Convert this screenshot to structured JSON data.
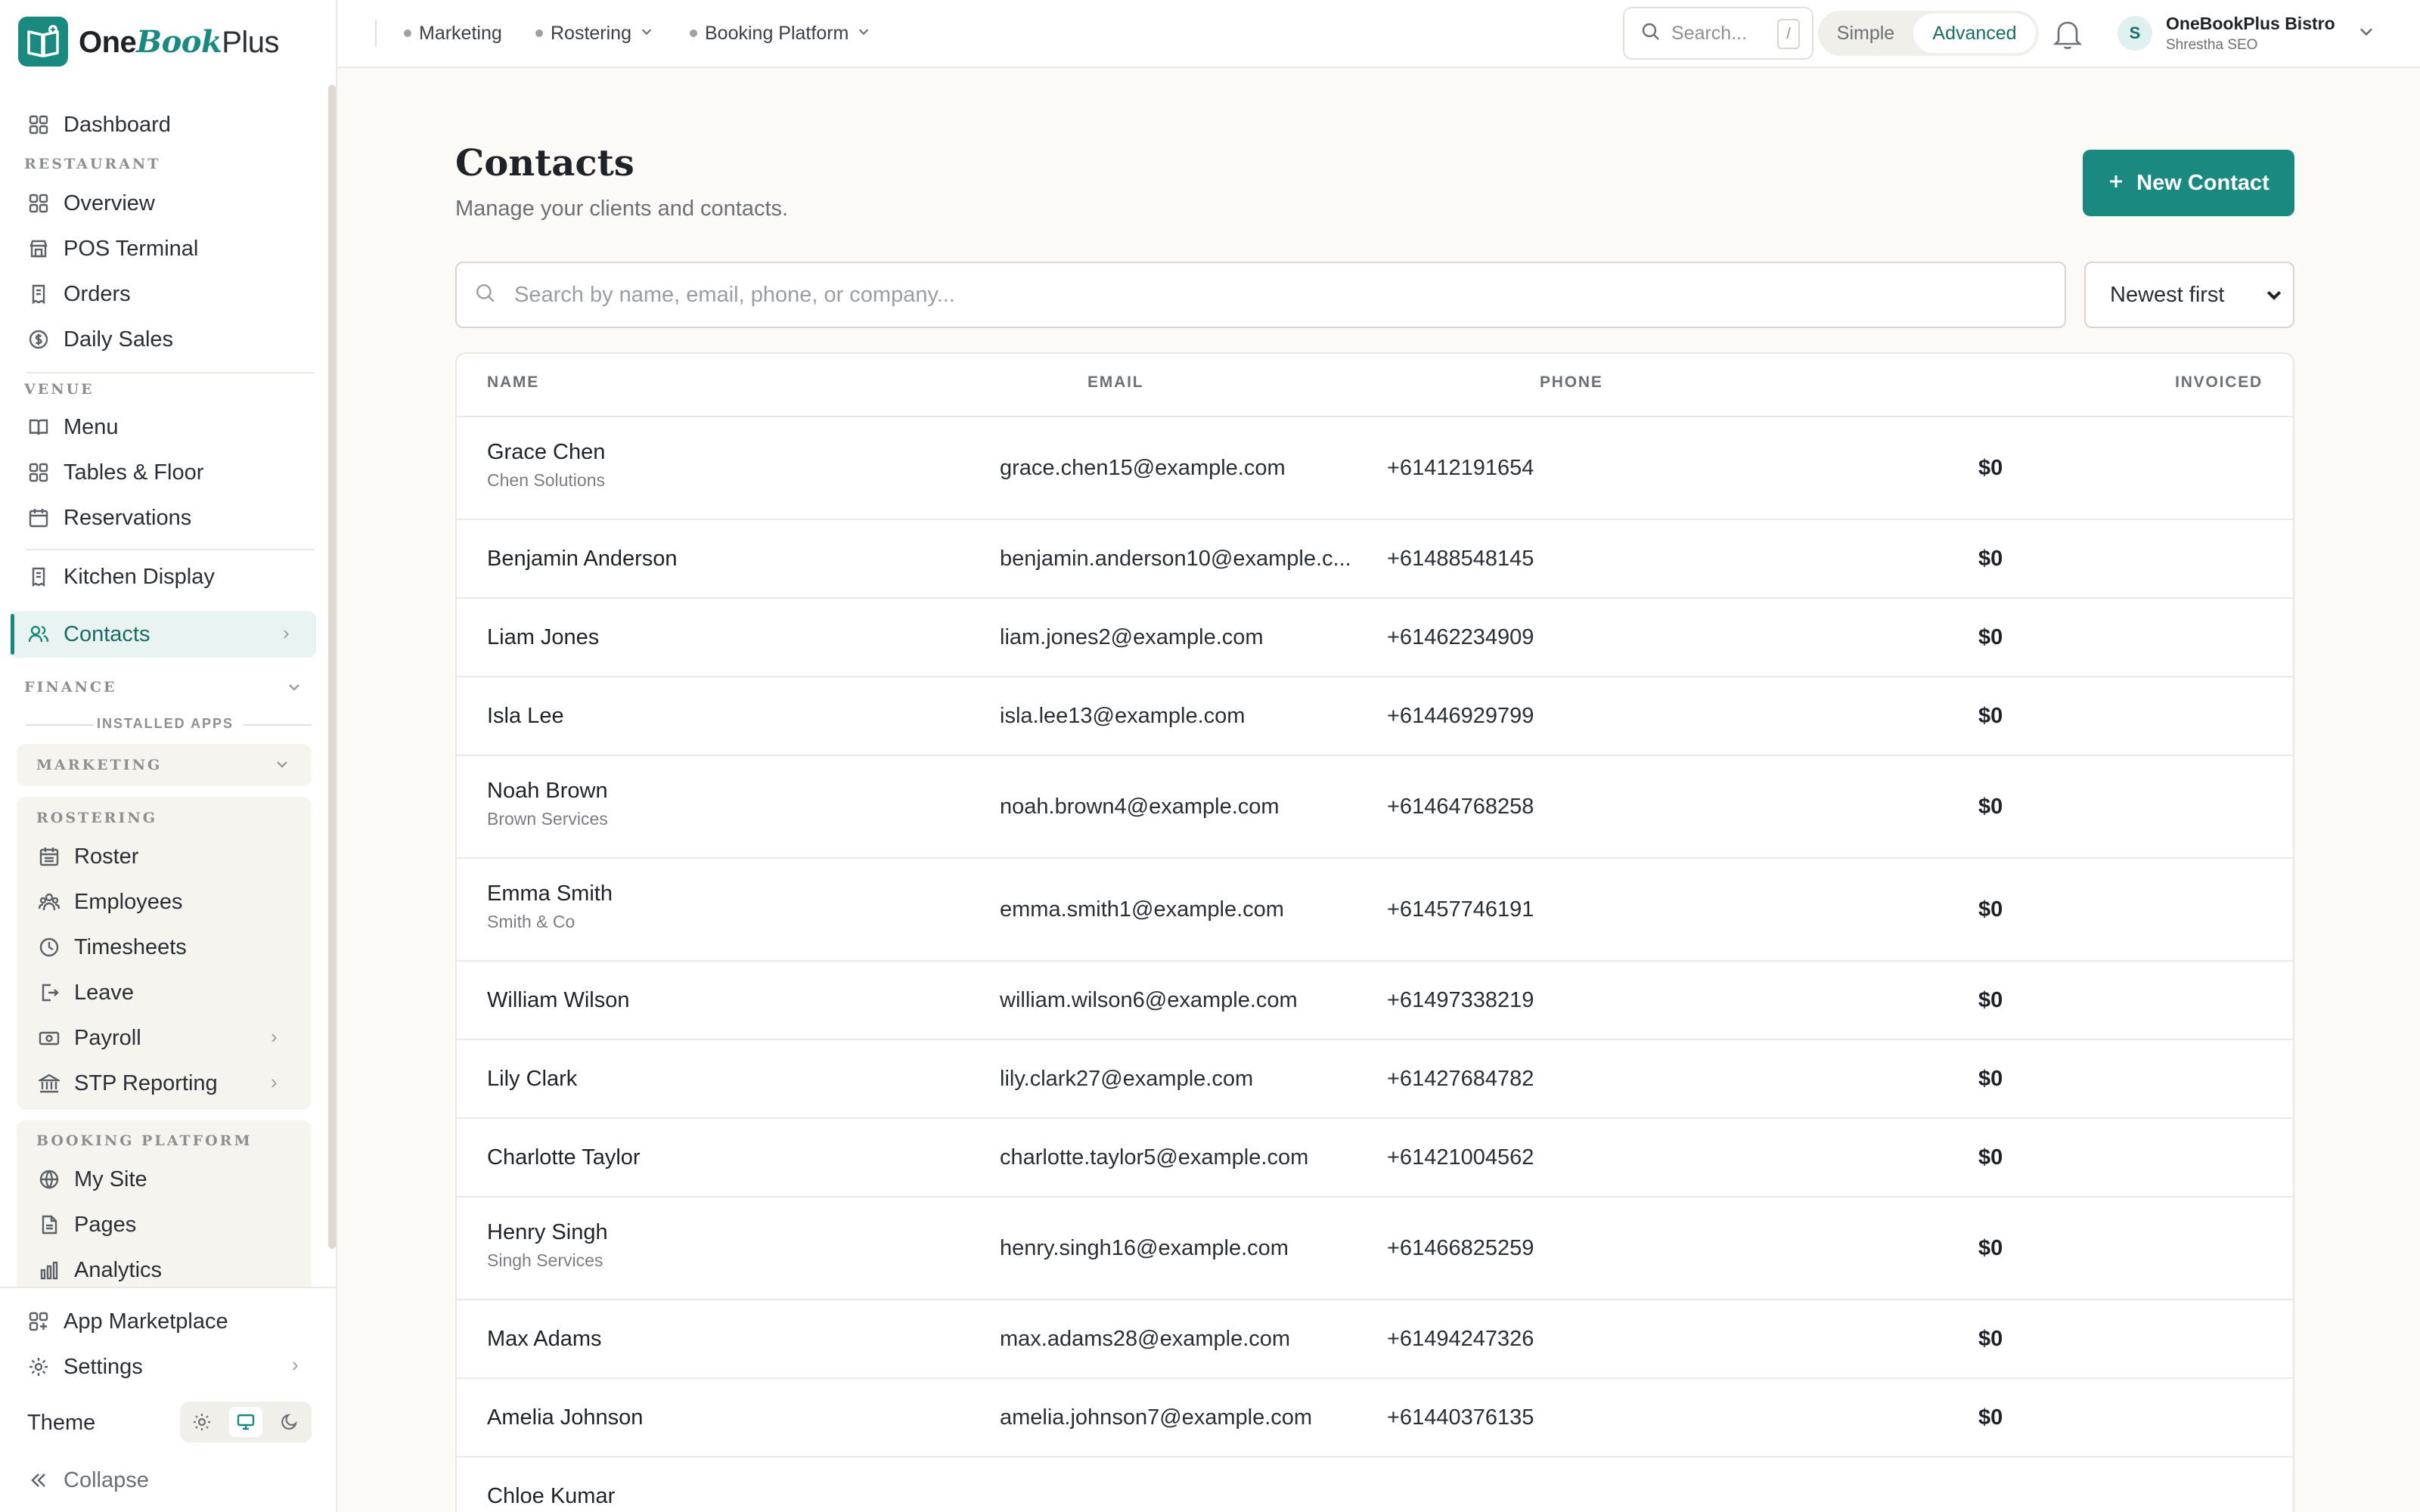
{
  "brand": {
    "one": "One",
    "book": "Book",
    "plus": "Plus"
  },
  "sidebar": {
    "dashboard": "Dashboard",
    "restaurant_label": "RESTAURANT",
    "overview": "Overview",
    "pos_terminal": "POS Terminal",
    "orders": "Orders",
    "daily_sales": "Daily Sales",
    "venue_label": "VENUE",
    "menu": "Menu",
    "tables_floor": "Tables & Floor",
    "reservations": "Reservations",
    "kitchen_display": "Kitchen Display",
    "contacts": "Contacts",
    "finance_label": "FINANCE",
    "installed_apps_label": "INSTALLED APPS",
    "marketing_label": "MARKETING",
    "rostering_label": "ROSTERING",
    "roster": "Roster",
    "employees": "Employees",
    "timesheets": "Timesheets",
    "leave": "Leave",
    "payroll": "Payroll",
    "stp_reporting": "STP Reporting",
    "booking_platform_label": "BOOKING PLATFORM",
    "my_site": "My Site",
    "pages": "Pages",
    "analytics": "Analytics",
    "app_marketplace": "App Marketplace",
    "settings": "Settings",
    "theme_label": "Theme",
    "collapse": "Collapse"
  },
  "topbar": {
    "marketing": "Marketing",
    "rostering": "Rostering",
    "booking_platform": "Booking Platform",
    "search_placeholder": "Search...",
    "search_shortcut": "/",
    "mode_simple": "Simple",
    "mode_advanced": "Advanced",
    "user_initial": "S",
    "business_name": "OneBookPlus Bistro",
    "user_name": "Shrestha SEO"
  },
  "page": {
    "title": "Contacts",
    "subtitle": "Manage your clients and contacts.",
    "new_button": "New Contact",
    "search_placeholder": "Search by name, email, phone, or company...",
    "sort_value": "Newest first"
  },
  "table": {
    "headers": {
      "name": "NAME",
      "email": "EMAIL",
      "phone": "PHONE",
      "invoiced": "INVOICED"
    },
    "rows": [
      {
        "name": "Grace Chen",
        "company": "Chen Solutions",
        "email": "grace.chen15@example.com",
        "phone": "+61412191654",
        "invoiced": "$0"
      },
      {
        "name": "Benjamin Anderson",
        "company": "",
        "email": "benjamin.anderson10@example.c...",
        "phone": "+61488548145",
        "invoiced": "$0"
      },
      {
        "name": "Liam Jones",
        "company": "",
        "email": "liam.jones2@example.com",
        "phone": "+61462234909",
        "invoiced": "$0"
      },
      {
        "name": "Isla Lee",
        "company": "",
        "email": "isla.lee13@example.com",
        "phone": "+61446929799",
        "invoiced": "$0"
      },
      {
        "name": "Noah Brown",
        "company": "Brown Services",
        "email": "noah.brown4@example.com",
        "phone": "+61464768258",
        "invoiced": "$0"
      },
      {
        "name": "Emma Smith",
        "company": "Smith & Co",
        "email": "emma.smith1@example.com",
        "phone": "+61457746191",
        "invoiced": "$0"
      },
      {
        "name": "William Wilson",
        "company": "",
        "email": "william.wilson6@example.com",
        "phone": "+61497338219",
        "invoiced": "$0"
      },
      {
        "name": "Lily Clark",
        "company": "",
        "email": "lily.clark27@example.com",
        "phone": "+61427684782",
        "invoiced": "$0"
      },
      {
        "name": "Charlotte Taylor",
        "company": "",
        "email": "charlotte.taylor5@example.com",
        "phone": "+61421004562",
        "invoiced": "$0"
      },
      {
        "name": "Henry Singh",
        "company": "Singh Services",
        "email": "henry.singh16@example.com",
        "phone": "+61466825259",
        "invoiced": "$0"
      },
      {
        "name": "Max Adams",
        "company": "",
        "email": "max.adams28@example.com",
        "phone": "+61494247326",
        "invoiced": "$0"
      },
      {
        "name": "Amelia Johnson",
        "company": "",
        "email": "amelia.johnson7@example.com",
        "phone": "+61440376135",
        "invoiced": "$0"
      },
      {
        "name": "Chloe Kumar",
        "company": "",
        "email": "",
        "phone": "",
        "invoiced": ""
      }
    ]
  },
  "colors": {
    "accent": "#1a8a80",
    "accent_bg": "#e9f3f1",
    "page_bg": "#fbfaf7"
  }
}
